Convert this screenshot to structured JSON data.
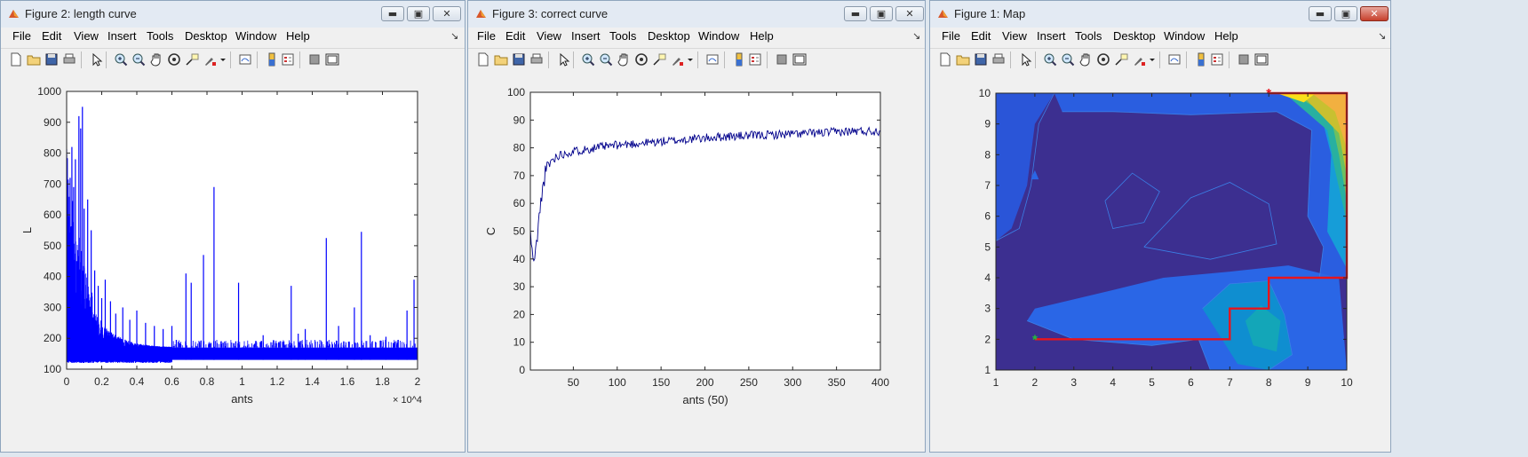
{
  "windows": [
    {
      "title": "Figure 2: length curve",
      "menu": [
        "File",
        "Edit",
        "View",
        "Insert",
        "Tools",
        "Desktop",
        "Window",
        "Help"
      ],
      "chart_data": {
        "type": "line",
        "title": "",
        "xlabel": "ants",
        "ylabel": "L",
        "xlim": [
          0,
          2
        ],
        "ylim": [
          100,
          1000
        ],
        "x_ticks": [
          "0",
          "0.2",
          "0.4",
          "0.6",
          "0.8",
          "1",
          "1.2",
          "1.4",
          "1.6",
          "1.8",
          "2"
        ],
        "y_ticks": [
          "100",
          "200",
          "300",
          "400",
          "500",
          "600",
          "700",
          "800",
          "900",
          "1000"
        ],
        "x_exponent": "× 10^4",
        "color": "#0000ff",
        "baseline_band": [
          130,
          170
        ],
        "spikes": [
          {
            "x": 0.005,
            "y": 700
          },
          {
            "x": 0.02,
            "y": 720
          },
          {
            "x": 0.03,
            "y": 820
          },
          {
            "x": 0.04,
            "y": 690
          },
          {
            "x": 0.05,
            "y": 780
          },
          {
            "x": 0.07,
            "y": 920
          },
          {
            "x": 0.08,
            "y": 880
          },
          {
            "x": 0.09,
            "y": 950
          },
          {
            "x": 0.1,
            "y": 620
          },
          {
            "x": 0.12,
            "y": 650
          },
          {
            "x": 0.14,
            "y": 550
          },
          {
            "x": 0.16,
            "y": 420
          },
          {
            "x": 0.18,
            "y": 370
          },
          {
            "x": 0.2,
            "y": 330
          },
          {
            "x": 0.22,
            "y": 390
          },
          {
            "x": 0.25,
            "y": 320
          },
          {
            "x": 0.28,
            "y": 280
          },
          {
            "x": 0.32,
            "y": 300
          },
          {
            "x": 0.36,
            "y": 260
          },
          {
            "x": 0.4,
            "y": 290
          },
          {
            "x": 0.45,
            "y": 250
          },
          {
            "x": 0.5,
            "y": 240
          },
          {
            "x": 0.55,
            "y": 230
          },
          {
            "x": 0.6,
            "y": 240
          },
          {
            "x": 0.68,
            "y": 410
          },
          {
            "x": 0.71,
            "y": 380
          },
          {
            "x": 0.78,
            "y": 470
          },
          {
            "x": 0.84,
            "y": 690
          },
          {
            "x": 0.98,
            "y": 380
          },
          {
            "x": 1.12,
            "y": 210
          },
          {
            "x": 1.28,
            "y": 370
          },
          {
            "x": 1.32,
            "y": 215
          },
          {
            "x": 1.36,
            "y": 230
          },
          {
            "x": 1.48,
            "y": 525
          },
          {
            "x": 1.55,
            "y": 240
          },
          {
            "x": 1.64,
            "y": 300
          },
          {
            "x": 1.68,
            "y": 545
          },
          {
            "x": 1.73,
            "y": 210
          },
          {
            "x": 1.82,
            "y": 205
          },
          {
            "x": 1.89,
            "y": 195
          },
          {
            "x": 1.94,
            "y": 290
          },
          {
            "x": 1.98,
            "y": 390
          }
        ]
      }
    },
    {
      "title": "Figure 3: correct curve",
      "menu": [
        "File",
        "Edit",
        "View",
        "Insert",
        "Tools",
        "Desktop",
        "Window",
        "Help"
      ],
      "chart_data": {
        "type": "line",
        "title": "",
        "xlabel": "ants (50)",
        "ylabel": "C",
        "xlim": [
          1,
          400
        ],
        "ylim": [
          0,
          100
        ],
        "x_ticks": [
          "50",
          "100",
          "150",
          "200",
          "250",
          "300",
          "350",
          "400"
        ],
        "y_ticks": [
          "0",
          "10",
          "20",
          "30",
          "40",
          "50",
          "60",
          "70",
          "80",
          "90",
          "100"
        ],
        "color": "#00008b",
        "trend": [
          {
            "x": 1,
            "y": 50
          },
          {
            "x": 3,
            "y": 42
          },
          {
            "x": 6,
            "y": 39
          },
          {
            "x": 10,
            "y": 52
          },
          {
            "x": 14,
            "y": 63
          },
          {
            "x": 18,
            "y": 71
          },
          {
            "x": 22,
            "y": 74
          },
          {
            "x": 30,
            "y": 77
          },
          {
            "x": 40,
            "y": 78
          },
          {
            "x": 55,
            "y": 79
          },
          {
            "x": 75,
            "y": 80
          },
          {
            "x": 100,
            "y": 81
          },
          {
            "x": 140,
            "y": 82
          },
          {
            "x": 180,
            "y": 83
          },
          {
            "x": 220,
            "y": 84
          },
          {
            "x": 260,
            "y": 84.5
          },
          {
            "x": 300,
            "y": 85
          },
          {
            "x": 340,
            "y": 85.5
          },
          {
            "x": 370,
            "y": 86
          },
          {
            "x": 400,
            "y": 86
          }
        ],
        "noise_amplitude": 1.6
      }
    },
    {
      "title": "Figure 1: Map",
      "menu": [
        "File",
        "Edit",
        "View",
        "Insert",
        "Tools",
        "Desktop",
        "Window",
        "Help"
      ],
      "chart_data": {
        "type": "heatmap",
        "title": "",
        "xlabel": "",
        "ylabel": "",
        "xlim": [
          1,
          10
        ],
        "ylim": [
          1,
          10
        ],
        "x_ticks": [
          "1",
          "2",
          "3",
          "4",
          "5",
          "6",
          "7",
          "8",
          "9",
          "10"
        ],
        "y_ticks": [
          "1",
          "2",
          "3",
          "4",
          "5",
          "6",
          "7",
          "8",
          "9",
          "10"
        ],
        "path": [
          [
            2,
            2
          ],
          [
            7,
            2
          ],
          [
            7,
            3
          ],
          [
            8,
            3
          ],
          [
            8,
            4
          ],
          [
            10,
            4
          ],
          [
            10,
            10
          ],
          [
            8,
            10
          ]
        ],
        "path_color": "#e8141c",
        "start": {
          "x": 2,
          "y": 2,
          "color": "#22c03a"
        },
        "end": {
          "x": 8,
          "y": 10,
          "color": "#e8141c"
        }
      }
    }
  ]
}
